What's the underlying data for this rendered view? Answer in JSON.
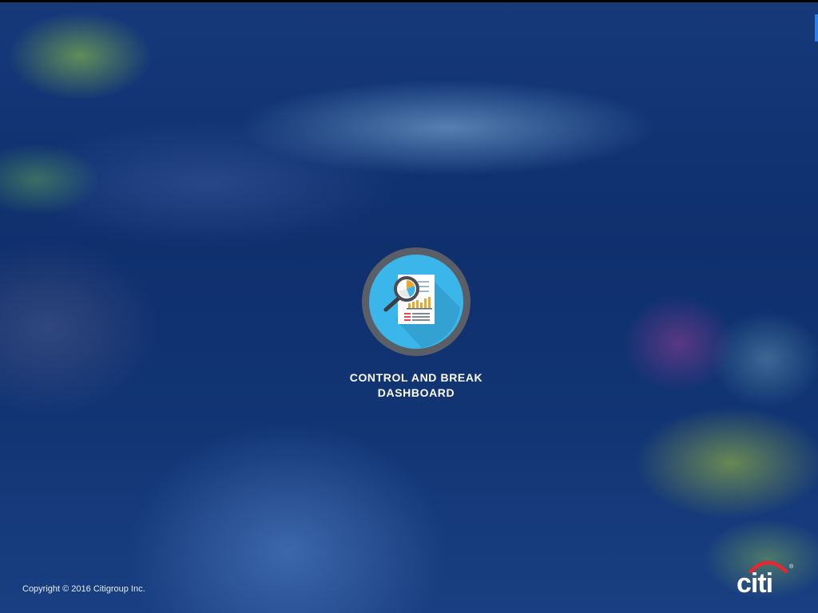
{
  "app_tile": {
    "label_line1": "CONTROL AND BREAK",
    "label_line2": "DASHBOARD",
    "icon": "report-magnifier-icon"
  },
  "footer": {
    "copyright": "Copyright © 2016 Citigroup Inc."
  },
  "brand": {
    "logo_text": "citi",
    "logo_icon": "citi-logo",
    "registered_mark": "®"
  },
  "colors": {
    "background": "#0d2d6b",
    "icon_ring": "#5a5e66",
    "icon_fill": "#3bb6ea",
    "logo_arc": "#e8262d",
    "text": "#ffffff"
  }
}
